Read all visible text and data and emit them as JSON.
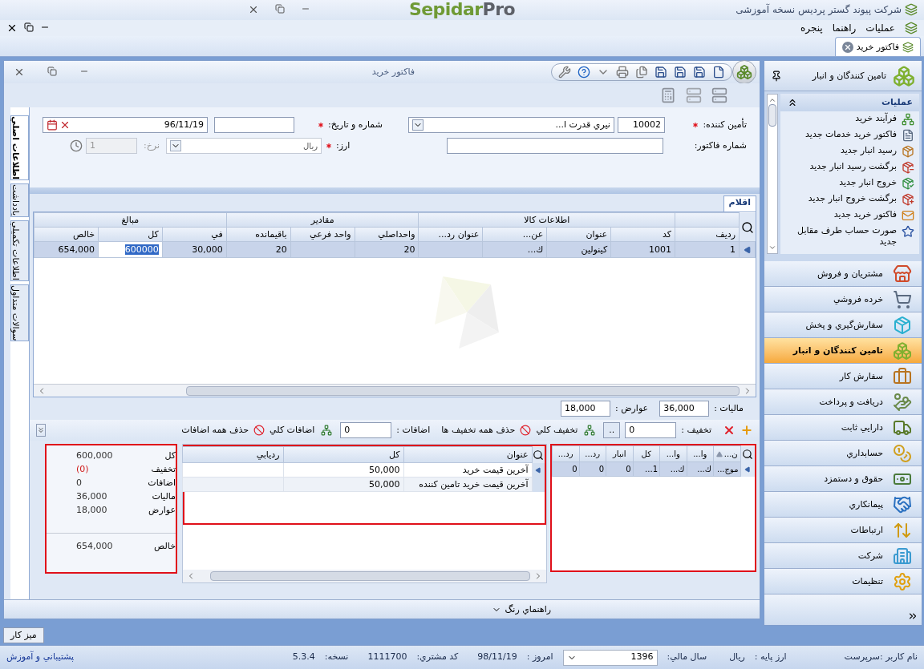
{
  "app": {
    "company": "شرکت پیوند گستر پردیس نسخه آموزشی",
    "logo_main": "Sepidar",
    "logo_accent": "Pro"
  },
  "menu": [
    "عملیات",
    "راهنما",
    "پنجره"
  ],
  "doc_tabs": [
    {
      "label": "فاکتور خرید",
      "selected": true
    }
  ],
  "window": {
    "title": "فاکتور خرید"
  },
  "form": {
    "supplier": {
      "label": "تأمین کننده:",
      "required": true,
      "code": "10002",
      "name": "نيري قدرت ا..."
    },
    "number_date": {
      "label": "شماره و تاریخ:",
      "required": true,
      "date": "96/11/19"
    },
    "invoice_number": {
      "label": "شماره فاکتور:",
      "required": false
    },
    "currency": {
      "label": "ارز:",
      "required": true,
      "value": "ريال"
    },
    "rate": {
      "label": "نرخ:",
      "value": "1",
      "disabled": true
    }
  },
  "side_tabs": [
    {
      "label": "اطلاعات اصلي",
      "selected": true
    },
    {
      "label": "يادداشت",
      "selected": false
    },
    {
      "label": "اطلاعات تكميلي",
      "selected": false
    },
    {
      "label": "سوالات متداول",
      "selected": false
    }
  ],
  "items_tab": {
    "label": "اقلام",
    "selected": true
  },
  "grid": {
    "groups": [
      {
        "columns": [
          "رديف"
        ]
      },
      {
        "label": "اطلاعات كالا",
        "columns": [
          "كد",
          "عنوان",
          "عن...",
          "عنوان رد..."
        ]
      },
      {
        "label": "مقادير",
        "columns": [
          "واحداصلي",
          "واحد فرعي",
          "باقيمانده"
        ]
      },
      {
        "label": "مبالغ",
        "columns": [
          "في",
          "كل",
          "خالص"
        ]
      }
    ],
    "rows": [
      {
        "selected": true,
        "cells": [
          {
            "text": "1",
            "editing": false
          },
          {
            "text": "1001",
            "editing": false
          },
          {
            "text": "كينولين",
            "editing": false
          },
          {
            "text": "ك...",
            "editing": false
          },
          {
            "text": null,
            "editing": false
          },
          {
            "text": "20",
            "editing": false
          },
          {
            "text": null,
            "editing": false
          },
          {
            "text": "20",
            "editing": false
          },
          {
            "text": "30,000",
            "editing": false
          },
          {
            "text": "600000",
            "editing": true
          },
          {
            "text": "654,000",
            "editing": false
          }
        ]
      }
    ]
  },
  "totals": [
    {
      "label": "ماليات :",
      "value": "36,000"
    },
    {
      "label": "عوارض :",
      "value": "18,000"
    }
  ],
  "adjust_bar": {
    "discount_label": "تخفيف :",
    "discount": "0",
    "more": "..",
    "discount_all": "تخفيف كلي",
    "remove_discounts": "حذف همه تخفيف ها",
    "additions_label": "اضافات :",
    "additions": "0",
    "additions_all": "اضافات كلي",
    "remove_additions": "حذف همه اضافات"
  },
  "stock_grid": {
    "columns": [
      {
        "label": "ن...",
        "sorted": true
      },
      {
        "label": "وا...",
        "sorted": false
      },
      {
        "label": "وا...",
        "sorted": false
      },
      {
        "label": "كل",
        "sorted": false
      },
      {
        "label": "انبار",
        "sorted": false
      },
      {
        "label": "رد...",
        "sorted": false
      },
      {
        "label": "رد...",
        "sorted": false
      }
    ],
    "rows": [
      {
        "selected": true,
        "cells": [
          "موج...",
          "ك...",
          "ك...",
          "1...",
          "0",
          "0",
          "0"
        ]
      }
    ]
  },
  "price_grid": {
    "columns": [
      "عنوان",
      "كل",
      "رديابي"
    ],
    "rows": [
      {
        "selected": true,
        "cells": [
          "آخرين قيمت خريد",
          "50,000",
          null
        ]
      },
      {
        "selected": false,
        "cells": [
          "آخرين قيمت خريد تامين كننده",
          "50,000",
          null
        ]
      }
    ]
  },
  "summary": [
    {
      "label": "كل",
      "value": "600,000",
      "negative": false
    },
    {
      "label": "تخفيف",
      "value": "(0)",
      "negative": true
    },
    {
      "label": "اضافات",
      "value": "0",
      "negative": false
    },
    {
      "label": "ماليات",
      "value": "36,000",
      "negative": false
    },
    {
      "label": "عوارض",
      "value": "18,000",
      "negative": false
    },
    {
      "label": "خالص",
      "value": "654,000",
      "negative": false
    }
  ],
  "color_guide": "راهنماي رنگ",
  "sidebar": {
    "title": "تامين كنندگان و انبار",
    "section": {
      "title": "عمليات",
      "expanded": true,
      "links": [
        "فرآيند خريد",
        "فاكتور خريد خدمات جديد",
        "رسيد انبار جديد",
        "برگشت رسيد انبار جديد",
        "خروج انبار جديد",
        "برگشت خروج انبار جديد",
        "فاكتور خريد جديد",
        "صورت حساب طرف مقابل جديد"
      ]
    },
    "modules": [
      {
        "label": "مشتريان و فروش",
        "selected": false
      },
      {
        "label": "خرده فروشي",
        "selected": false
      },
      {
        "label": "سفارش‌گيري و پخش",
        "selected": false
      },
      {
        "label": "تامين كنندگان و انبار",
        "selected": true
      },
      {
        "label": "سفارش كار",
        "selected": false
      },
      {
        "label": "دريافت و پرداخت",
        "selected": false
      },
      {
        "label": "دارايي ثابت",
        "selected": false
      },
      {
        "label": "حسابداري",
        "selected": false
      },
      {
        "label": "حقوق و دستمزد",
        "selected": false
      },
      {
        "label": "پيمانكاري",
        "selected": false
      },
      {
        "label": "ارتباطات",
        "selected": false
      },
      {
        "label": "شركت",
        "selected": false
      },
      {
        "label": "تنظيمات",
        "selected": false
      }
    ]
  },
  "desk_button": "ميز كار",
  "status": {
    "user": "نام كاربر :سرپرست",
    "base_currency_label": "ارز پايه :",
    "base_currency": "ريال",
    "fiscal_year_label": "سال مالي:",
    "fiscal_year": "1396",
    "today_label": "امروز :",
    "today": "98/11/19",
    "customer_code_label": "كد مشتري:",
    "customer_code": "1111700",
    "version_label": "نسخه:",
    "version": "5.3.4",
    "support": "پشتيباني و آموزش"
  }
}
